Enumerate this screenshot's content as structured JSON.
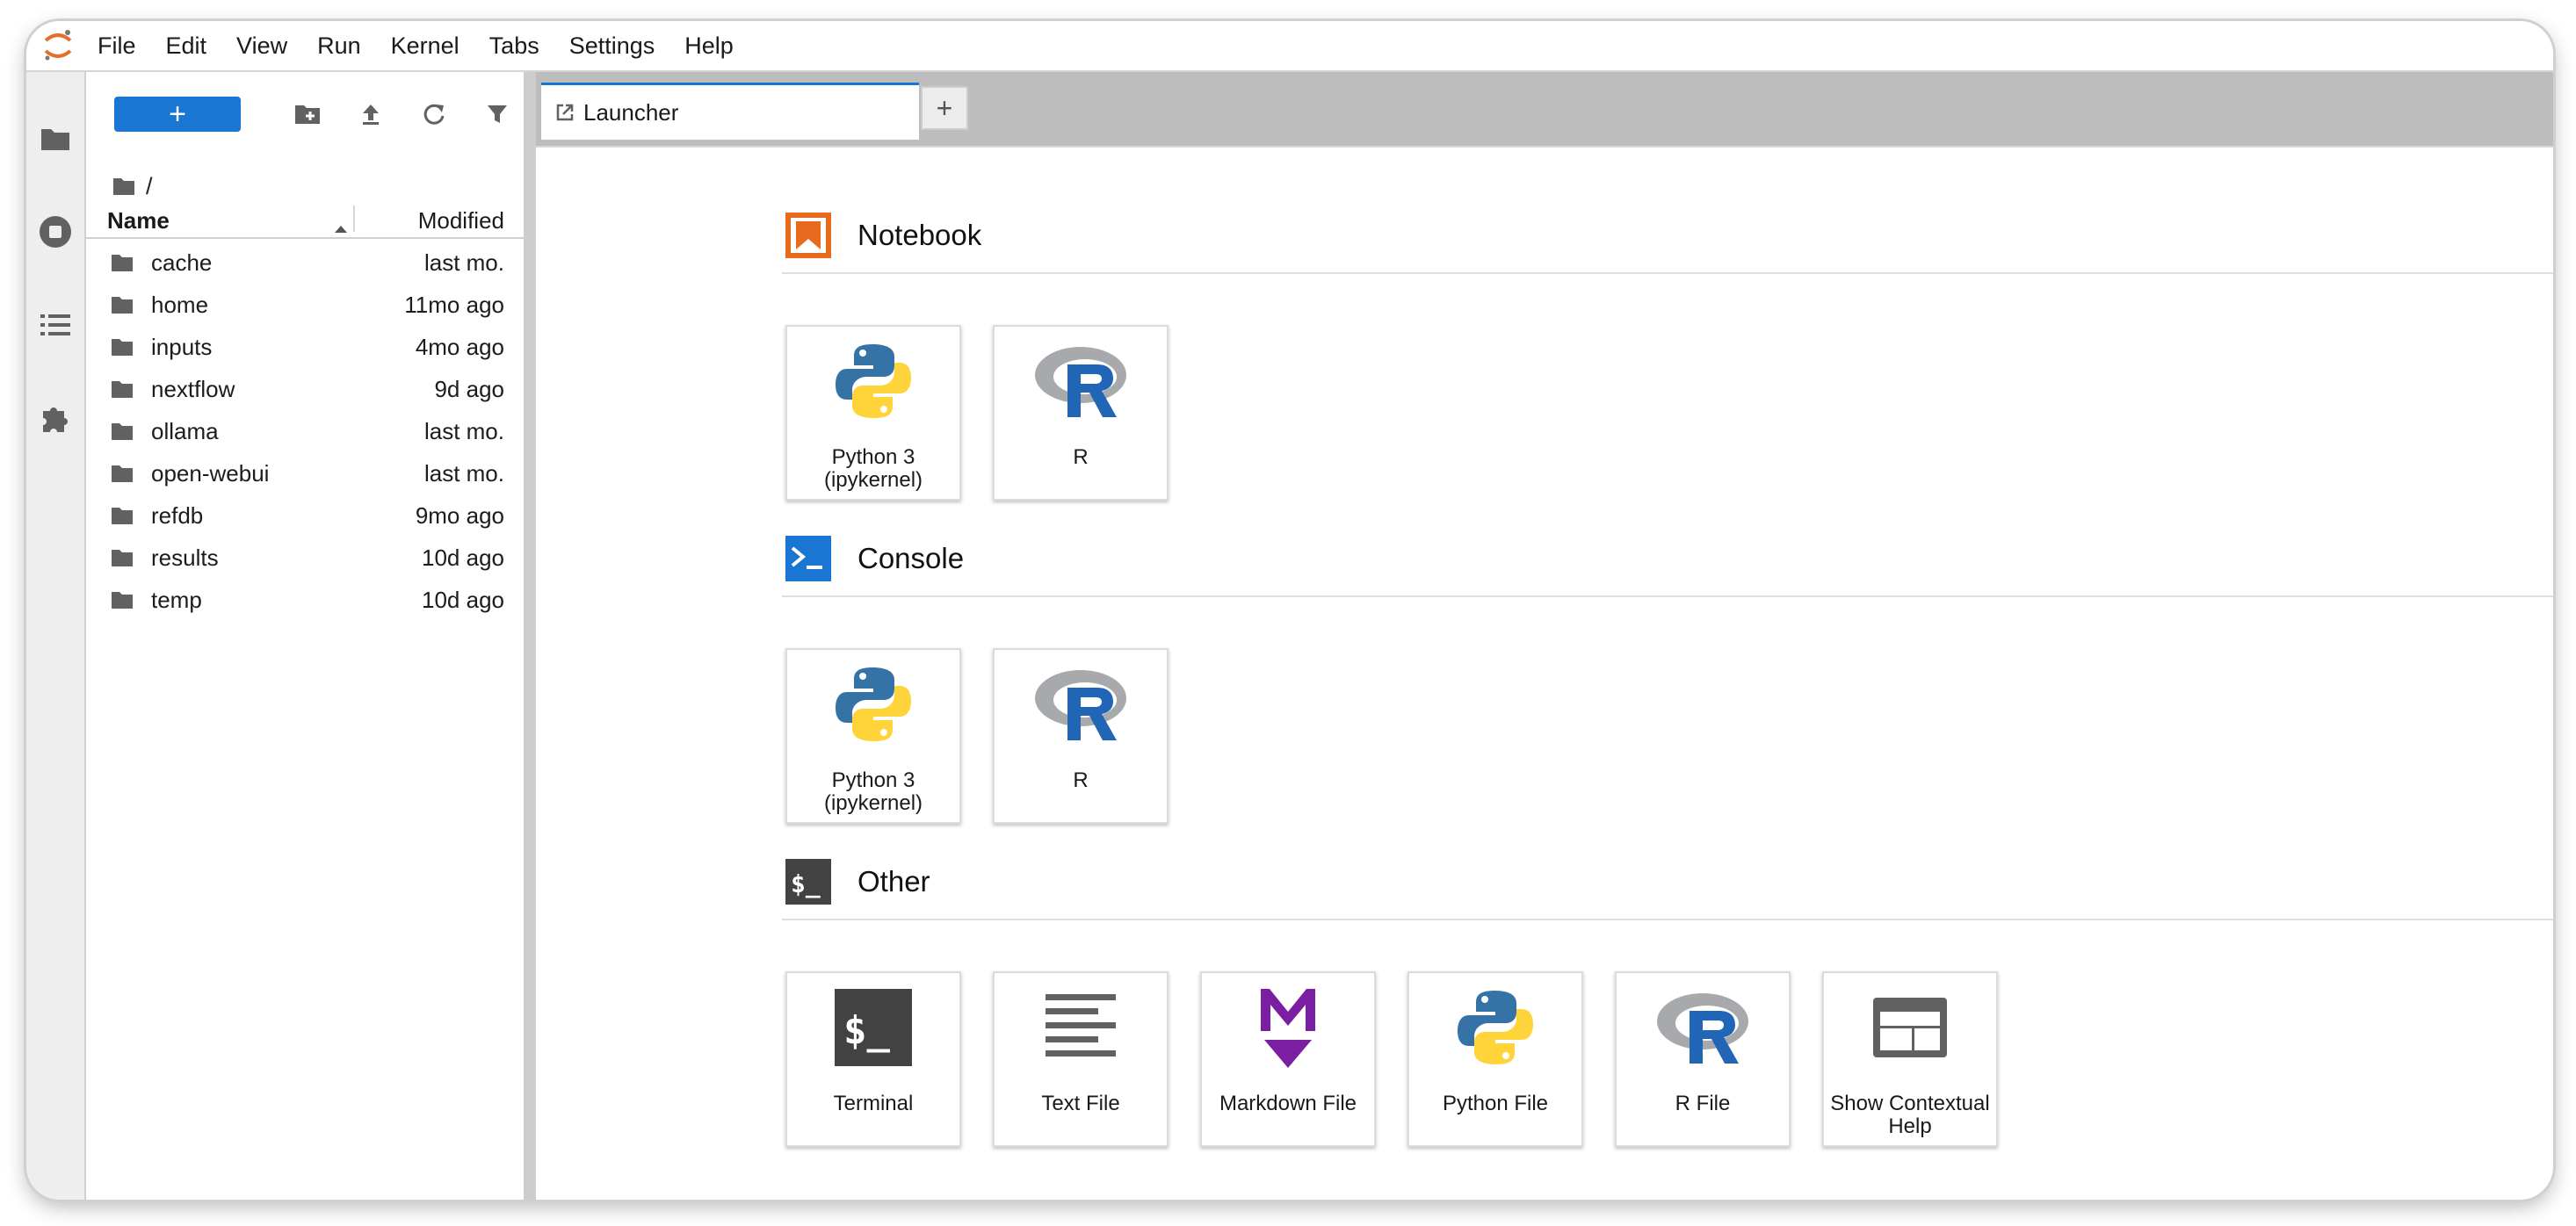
{
  "menubar": {
    "items": [
      "File",
      "Edit",
      "View",
      "Run",
      "Kernel",
      "Tabs",
      "Settings",
      "Help"
    ]
  },
  "activity_bar": {
    "icons": [
      "folder-icon",
      "stop-circle-icon",
      "list-icon",
      "puzzle-icon"
    ]
  },
  "filebrowser": {
    "new_label": "+",
    "breadcrumb": "/",
    "columns": {
      "name": "Name",
      "modified": "Modified"
    },
    "files": [
      {
        "name": "cache",
        "modified": "last mo."
      },
      {
        "name": "home",
        "modified": "11mo ago"
      },
      {
        "name": "inputs",
        "modified": "4mo ago"
      },
      {
        "name": "nextflow",
        "modified": "9d ago"
      },
      {
        "name": "ollama",
        "modified": "last mo."
      },
      {
        "name": "open-webui",
        "modified": "last mo."
      },
      {
        "name": "refdb",
        "modified": "9mo ago"
      },
      {
        "name": "results",
        "modified": "10d ago"
      },
      {
        "name": "temp",
        "modified": "10d ago"
      }
    ]
  },
  "tabs": {
    "active": "Launcher",
    "add_label": "+"
  },
  "launcher": {
    "sections": [
      {
        "title": "Notebook",
        "items": [
          {
            "label": "Python 3 (ipykernel)",
            "icon": "python-icon"
          },
          {
            "label": "R",
            "icon": "r-logo-icon"
          }
        ]
      },
      {
        "title": "Console",
        "items": [
          {
            "label": "Python 3 (ipykernel)",
            "icon": "python-icon"
          },
          {
            "label": "R",
            "icon": "r-logo-icon"
          }
        ]
      },
      {
        "title": "Other",
        "items": [
          {
            "label": "Terminal",
            "icon": "terminal-icon"
          },
          {
            "label": "Text File",
            "icon": "text-file-icon"
          },
          {
            "label": "Markdown File",
            "icon": "markdown-icon"
          },
          {
            "label": "Python File",
            "icon": "python-icon"
          },
          {
            "label": "R File",
            "icon": "r-logo-icon"
          },
          {
            "label": "Show Contextual Help",
            "icon": "contextual-help-icon"
          }
        ]
      }
    ]
  },
  "colors": {
    "accent": "#1976d2",
    "notebook_icon": "#e86a1f",
    "console_icon": "#1976d2",
    "other_icon": "#424242",
    "markdown": "#7b1fa2"
  }
}
